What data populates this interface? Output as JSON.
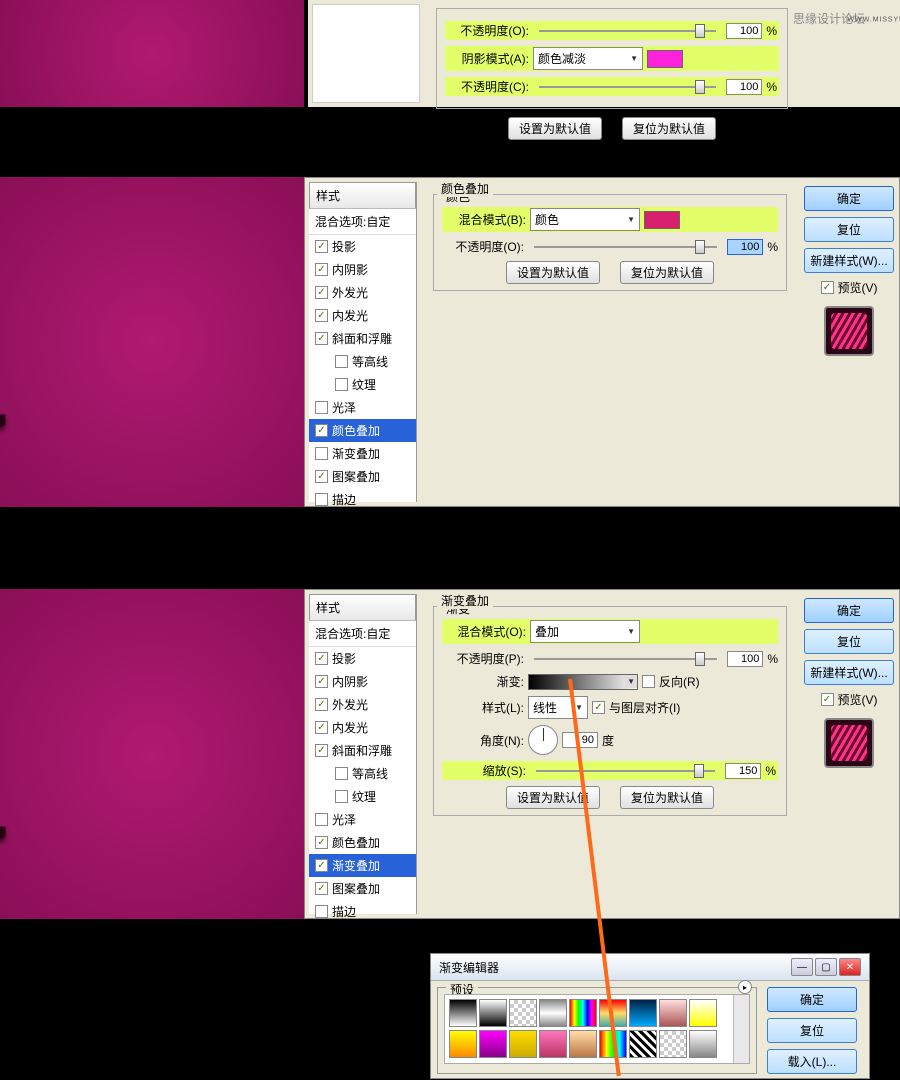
{
  "watermark": "思缘设计论坛",
  "watermark_url": "WWW.MISSYUAN.COM",
  "panel1": {
    "rows": {
      "opacity_o": {
        "label": "不透明度(O):",
        "value": "100",
        "pct": "%"
      },
      "shadow_mode": {
        "label": "阴影模式(A):",
        "value": "颜色减淡",
        "color": "#ff22dd"
      },
      "opacity_c": {
        "label": "不透明度(C):",
        "value": "100",
        "pct": "%"
      }
    },
    "btn_default": "设置为默认值",
    "btn_reset": "复位为默认值"
  },
  "panel2": {
    "styles_header": "样式",
    "blend_options": "混合选项:自定",
    "items": [
      {
        "label": "投影",
        "checked": true
      },
      {
        "label": "内阴影",
        "checked": true
      },
      {
        "label": "外发光",
        "checked": true
      },
      {
        "label": "内发光",
        "checked": true
      },
      {
        "label": "斜面和浮雕",
        "checked": true
      },
      {
        "label": "等高线",
        "checked": false,
        "indent": true
      },
      {
        "label": "纹理",
        "checked": false,
        "indent": true
      },
      {
        "label": "光泽",
        "checked": false
      },
      {
        "label": "颜色叠加",
        "checked": true,
        "selected": true
      },
      {
        "label": "渐变叠加",
        "checked": false
      },
      {
        "label": "图案叠加",
        "checked": true
      },
      {
        "label": "描边",
        "checked": false
      }
    ],
    "section_title": "颜色叠加",
    "inner_title": "颜色",
    "blend_mode": {
      "label": "混合模式(B):",
      "value": "颜色",
      "color": "#d8206f"
    },
    "opacity": {
      "label": "不透明度(O):",
      "value": "100",
      "pct": "%"
    },
    "btn_default": "设置为默认值",
    "btn_reset": "复位为默认值",
    "side": {
      "ok": "确定",
      "reset": "复位",
      "new_style": "新建样式(W)...",
      "preview": "预览(V)"
    }
  },
  "panel3": {
    "styles_header": "样式",
    "blend_options": "混合选项:自定",
    "items": [
      {
        "label": "投影",
        "checked": true
      },
      {
        "label": "内阴影",
        "checked": true
      },
      {
        "label": "外发光",
        "checked": true
      },
      {
        "label": "内发光",
        "checked": true
      },
      {
        "label": "斜面和浮雕",
        "checked": true
      },
      {
        "label": "等高线",
        "checked": false,
        "indent": true
      },
      {
        "label": "纹理",
        "checked": false,
        "indent": true
      },
      {
        "label": "光泽",
        "checked": false
      },
      {
        "label": "颜色叠加",
        "checked": true
      },
      {
        "label": "渐变叠加",
        "checked": true,
        "selected": true
      },
      {
        "label": "图案叠加",
        "checked": true
      },
      {
        "label": "描边",
        "checked": false
      }
    ],
    "section_title": "渐变叠加",
    "inner_title": "渐变",
    "blend_mode": {
      "label": "混合模式(O):",
      "value": "叠加"
    },
    "opacity": {
      "label": "不透明度(P):",
      "value": "100",
      "pct": "%"
    },
    "gradient": {
      "label": "渐变:",
      "reverse": "反向(R)"
    },
    "style": {
      "label": "样式(L):",
      "value": "线性",
      "align": "与图层对齐(I)"
    },
    "angle": {
      "label": "角度(N):",
      "value": "90",
      "unit": "度"
    },
    "scale": {
      "label": "缩放(S):",
      "value": "150",
      "pct": "%"
    },
    "btn_default": "设置为默认值",
    "btn_reset": "复位为默认值",
    "side": {
      "ok": "确定",
      "reset": "复位",
      "new_style": "新建样式(W)...",
      "preview": "预览(V)"
    }
  },
  "panel4": {
    "title": "渐变编辑器",
    "preset_label": "预设",
    "side": {
      "ok": "确定",
      "reset": "复位",
      "load": "载入(L)..."
    },
    "swatches": [
      "linear-gradient(#000,#fff)",
      "linear-gradient(#fff,#000)",
      "repeating-conic-gradient(#ccc 0 25%,#fff 0 50%) 0 0/8px 8px",
      "linear-gradient(#888,#fff,#888)",
      "linear-gradient(90deg,#f00,#ff0,#0f0,#0ff,#00f,#f0f,#f00)",
      "linear-gradient(#f00,#ffdd66,#4aa)",
      "linear-gradient(#024,#0af)",
      "linear-gradient(#fdd,#a55)",
      "linear-gradient(#fff,#ff0)",
      "linear-gradient(#ff0,#f80)",
      "linear-gradient(#f0f,#808)",
      "linear-gradient(#fd0,#ca0)",
      "linear-gradient(#f7b,#b36)",
      "linear-gradient(#fda,#b74)",
      "linear-gradient(90deg,#f00,#ff0,#0f0,#0ff,#00f)",
      "repeating-linear-gradient(45deg,#000,#000 3px,#fff 3px,#fff 6px)",
      "repeating-conic-gradient(#ccc 0 25%,#fff 0 50%) 0 0/8px 8px",
      "linear-gradient(#fff,#888)"
    ]
  }
}
